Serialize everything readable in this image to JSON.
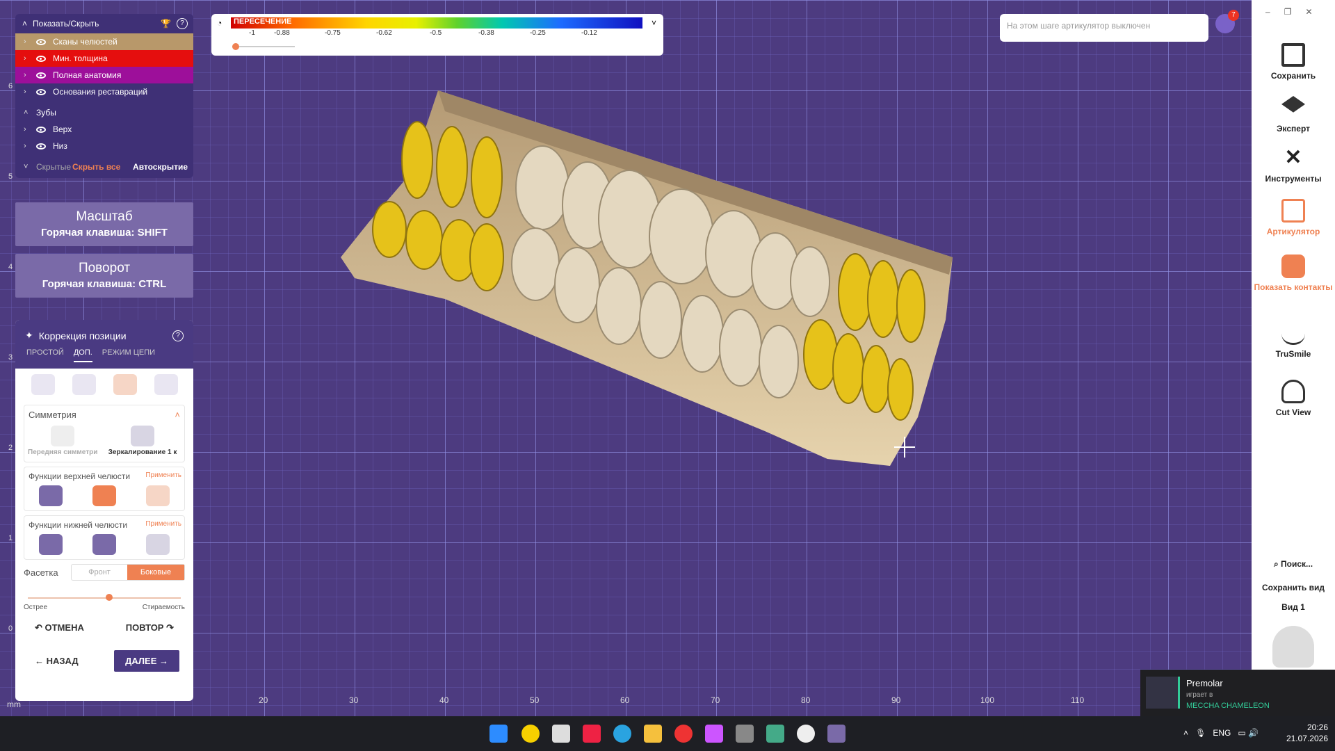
{
  "layers": {
    "header": "Показать/Скрыть",
    "items": [
      {
        "label": "Сканы челюстей",
        "color": "#b8986a"
      },
      {
        "label": "Мин. толщина",
        "color": "#e50e0e"
      },
      {
        "label": "Полная анатомия",
        "color": "#9d0f9a"
      },
      {
        "label": "Основания реставраций",
        "color": ""
      }
    ],
    "group_title": "Зубы",
    "group_items": [
      "Верх",
      "Низ"
    ],
    "footer_hidden": "Скрытые",
    "footer_hide_all": "Скрыть все",
    "footer_auto": "Автоскрытие"
  },
  "zoom_btn": {
    "title": "Масштаб",
    "hotkey": "Горячая клавиша: SHIFT"
  },
  "rotate_btn": {
    "title": "Поворот",
    "hotkey": "Горячая клавиша: CTRL"
  },
  "correction": {
    "title": "Коррекция позиции",
    "tabs": [
      "ПРОСТОЙ",
      "ДОП.",
      "РЕЖИМ ЦЕПИ"
    ],
    "symmetry_title": "Симметрия",
    "symmetry_items": [
      "Передняя симметрия",
      "Зеркалирование 1 к"
    ],
    "upper_title": "Функции верхней челюсти",
    "lower_title": "Функции нижней челюсти",
    "apply": "Применить",
    "facet_label": "Фасетка",
    "facet_options": [
      "Фронт",
      "Боковые"
    ],
    "slider_left": "Острее",
    "slider_right": "Стираемость",
    "slider_value": 0.53,
    "undo": "ОТМЕНА",
    "redo": "ПОВТОР",
    "back": "НАЗАД",
    "next": "ДАЛЕЕ"
  },
  "intersection": {
    "label": "ПЕРЕСЕЧЕНИЕ",
    "ticks": [
      "-1",
      "-0.88",
      "-0.75",
      "-0.62",
      "-0.5",
      "-0.38",
      "-0.25",
      "-0.12"
    ]
  },
  "notification": {
    "placeholder": "На этом шаге артикулятор выключен",
    "badge": "7"
  },
  "rightbar": [
    {
      "label": "Сохранить",
      "icon": "save-icon"
    },
    {
      "label": "Эксперт",
      "icon": "expert-icon"
    },
    {
      "label": "Инструменты",
      "icon": "tools-icon"
    },
    {
      "label": "Артикулятор",
      "icon": "articulator-icon"
    },
    {
      "label": "Показать контакты",
      "icon": "contacts-icon"
    },
    {
      "label": "TruSmile",
      "icon": "trusmile-icon"
    },
    {
      "label": "Cut View",
      "icon": "cutview-icon"
    }
  ],
  "search": "Поиск...",
  "save_view": "Сохранить вид",
  "view": "Вид 1",
  "ruler": {
    "unit": "mm",
    "x": [
      "20",
      "30",
      "40",
      "50",
      "60",
      "70",
      "80",
      "90",
      "100",
      "110"
    ],
    "y": [
      "6",
      "5",
      "4",
      "3",
      "2",
      "1",
      "0"
    ]
  },
  "stream": {
    "name": "Premolar",
    "status": "играет в",
    "game": "MECCHA CHAMELEON"
  },
  "taskbar": {
    "lang": "ENG",
    "time": "20:26",
    "date": "21.07.2026"
  }
}
